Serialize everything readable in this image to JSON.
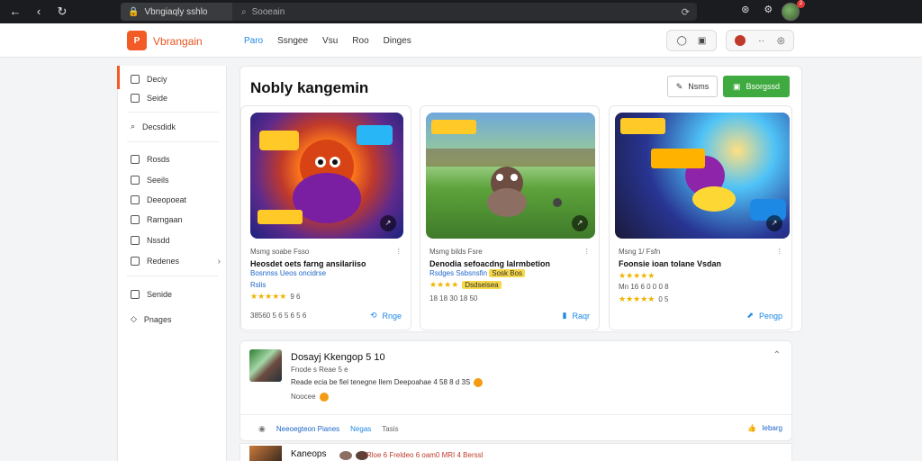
{
  "browser": {
    "tab_title": "Vbngiaqly sshlo",
    "search_placeholder": "Sooeain",
    "notification_count": "2"
  },
  "header": {
    "brand": "Vbrangain",
    "logo_text": "P",
    "nav": [
      "Paro",
      "Ssngee",
      "Vsu",
      "Roo",
      "Dinges"
    ]
  },
  "sidebar": {
    "items": [
      {
        "label": "Deciy",
        "icon": "grid-icon"
      },
      {
        "label": "Seide",
        "icon": "grid-icon"
      },
      {
        "label": "Decsdidk",
        "icon": "search-icon"
      },
      {
        "label": "Rosds",
        "icon": "doc-icon"
      },
      {
        "label": "Seeils",
        "icon": "doc-icon"
      },
      {
        "label": "Deeopoeat",
        "icon": "chart-icon"
      },
      {
        "label": "Rarngaan",
        "icon": "list-icon"
      },
      {
        "label": "Nssdd",
        "icon": "grid-icon"
      },
      {
        "label": "Redenes",
        "icon": "folder-icon"
      },
      {
        "label": "Senide",
        "icon": "settings-icon"
      },
      {
        "label": "Pnages",
        "icon": "diamond-icon"
      }
    ]
  },
  "main": {
    "title": "Nobly kangemin",
    "new_button": "Nsms",
    "primary_button": "Bsorgssd",
    "games": [
      {
        "meta": "Msmg soabe Fsso",
        "title": "Heosdet oets farng ansilariiso",
        "subtitle": "Bosnnss Ueos oncidrse",
        "extra": "Rslis",
        "stars": "★★★★★",
        "count": "9 6",
        "stats": "38560 5 6 5 6 5 6",
        "action": "Rnge"
      },
      {
        "meta": "Msmg bilds Fsre",
        "title": "Denodia sefoacdng lalrmbetion",
        "subtitle": "Rsdges Ssbsnsfin",
        "tag": "Sosk Bos",
        "tag2": "Dsdseisea",
        "stars": "★★★★",
        "stats": "18 18 30 18 50",
        "action": "Raqr"
      },
      {
        "meta": "Msng 1/ Fsfn",
        "title": "Foonsie ioan tolane Vsdan",
        "subtitle": "Mn 16 6 0 0 0 8",
        "stars": "★★★★★",
        "count": "0 5",
        "stats": "",
        "action": "Pengp"
      }
    ]
  },
  "feed": {
    "title": "Dosayj Kkengop 5 10",
    "meta": "Fnode s Reae 5 e",
    "body": "Reade ecia be fiel tenegne Ilem Deepoahae 4 58 8 d 3S",
    "reply": "Noocee",
    "links": [
      "Neeoegteon Pianes",
      "Negas",
      "Tasis"
    ],
    "right": "Iebarg"
  },
  "feed2": {
    "title": "Kaneops",
    "rest": "Rloe 6 Freldeo 6 oam0 MRI 4 Berssl"
  }
}
